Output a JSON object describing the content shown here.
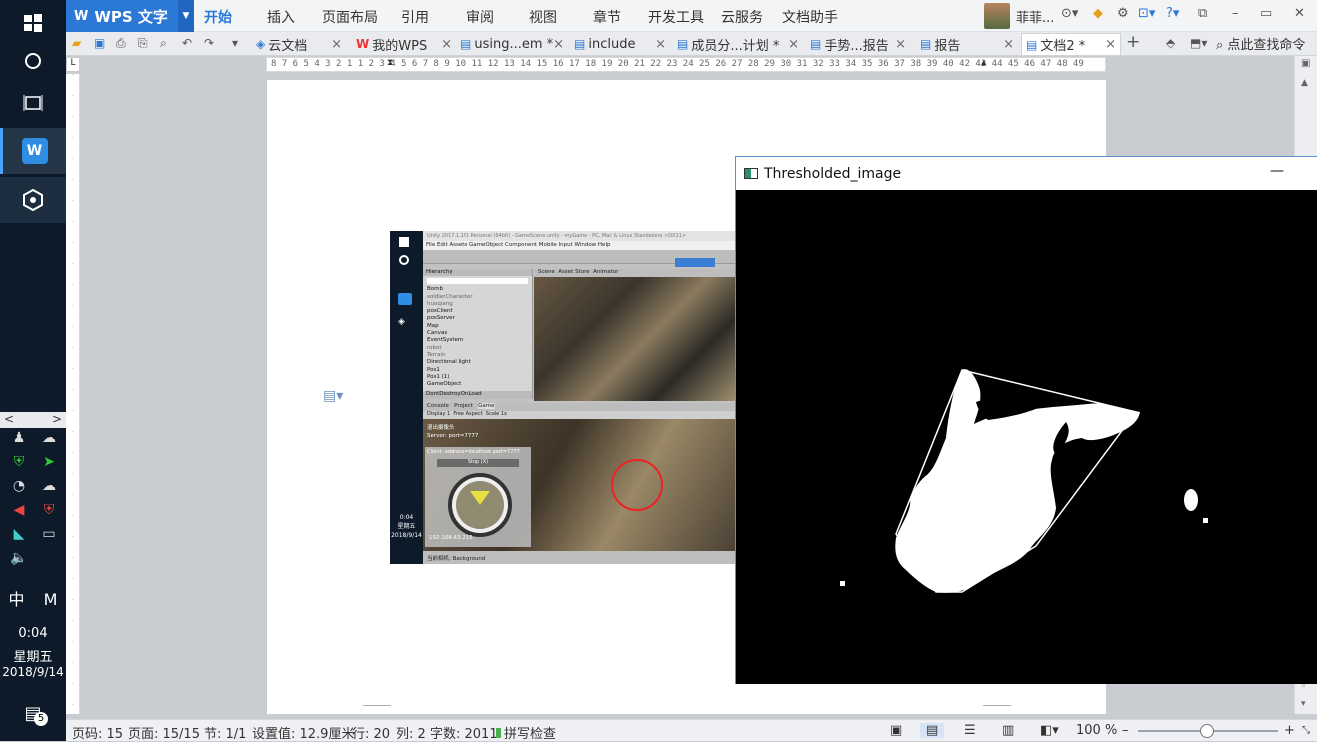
{
  "taskbar": {
    "time": "0:04",
    "weekday": "星期五",
    "date": "2018/9/14",
    "notification_count": "5",
    "ime_lang": "中",
    "ime_mode": "M"
  },
  "titlebar": {
    "app_name": "WPS 文字",
    "menu": [
      "开始",
      "插入",
      "页面布局",
      "引用",
      "审阅",
      "视图",
      "章节",
      "开发工具",
      "云服务",
      "文档助手"
    ],
    "user_name": "菲菲...",
    "window_controls": [
      "–",
      "▭",
      "✕"
    ]
  },
  "tabs": [
    {
      "label": "云文档",
      "icon": "cloud-icon"
    },
    {
      "label": "我的WPS",
      "icon": "wps-icon"
    },
    {
      "label": "using...em *",
      "icon": "doc-icon"
    },
    {
      "label": "include",
      "icon": "doc-icon"
    },
    {
      "label": "成员分...计划 *",
      "icon": "doc-icon"
    },
    {
      "label": "手势...报告",
      "icon": "doc-icon"
    },
    {
      "label": "报告",
      "icon": "doc-icon"
    },
    {
      "label": "文档2 *",
      "icon": "doc-icon",
      "active": true
    }
  ],
  "search_command": "点此查找命令",
  "ruler": {
    "numbers": "8  7  6  5  4  3  2  1      1  2  3  4  5  6  7  8  9  10 11 12 13 14 15 16 17 18 19 20 21 22 23 24 25 26 27 28 29 30 31 32 33 34 35 36 37 38 39 40    42 43 44 45 46 47 48 49"
  },
  "embedded_screenshot": {
    "title": "Unity 2017.1.1f1 Personal (64bit) - GameScene.unity - myGame - PC, Mac & Linux Standalone <DX11>",
    "menu": "File  Edit  Assets  GameObject  Component  Mobile Input  Window  Help",
    "hierarchy_items": [
      "Bomb",
      "soldierCharacter",
      "huoqiang",
      "posClient",
      "posServer",
      "Map",
      "Canvas",
      "EventSystem",
      "robot",
      "Terrain",
      "Directional light",
      "Pos1",
      "Pos1 (1)",
      "GameObject"
    ],
    "hierarchy_footer": "DontDestroyOnLoad",
    "server_text": "Server: port=7777",
    "client_text": "Client: address=localhost port=7777",
    "stop_label": "Stop (X)",
    "exit_label": "退出摄像头",
    "ip_text": "192.168.43.215",
    "status_text": "当前相机: Background",
    "tab_console": "Console",
    "tab_project": "Project",
    "tab_game": "Game",
    "tab_scene": "Scene",
    "tab_asset": "Asset Store",
    "tab_animator": "Animator",
    "display": "Display 1",
    "aspect": "Free Aspect",
    "scale": "Scale",
    "scale_value": "1x",
    "taskbar_time": "0:04",
    "taskbar_day": "星期五",
    "taskbar_date": "2018/9/14"
  },
  "threshold_window": {
    "title": "Thresholded_image",
    "minimize": "—"
  },
  "statusbar": {
    "page_code": "页码: 15",
    "pages": "页面: 15/15",
    "section": "节: 1/1",
    "setting": "设置值: 12.9厘米",
    "row": "行: 20",
    "col": "列: 2",
    "word_count": "字数: 2011",
    "spell_check": "拼写检查",
    "zoom": "100 %"
  },
  "colors": {
    "accent": "#2b78d6",
    "taskbar_bg": "#0c1a2a",
    "threshold_bg": "#000000",
    "threshold_fg": "#ffffff"
  }
}
